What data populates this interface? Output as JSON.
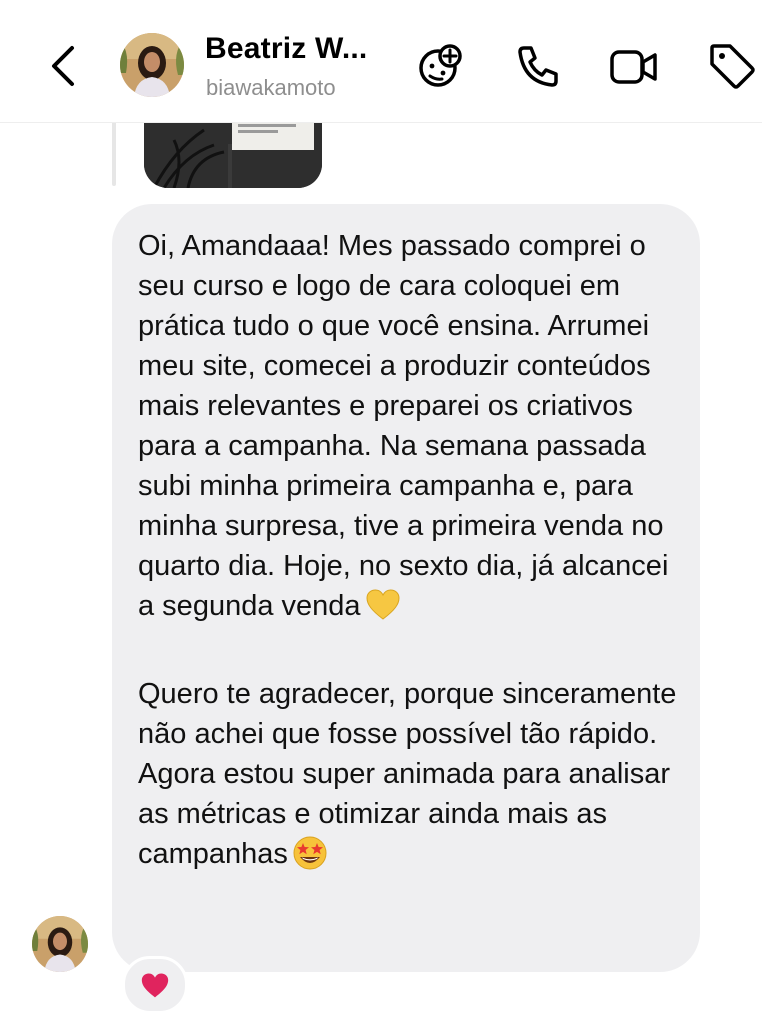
{
  "header": {
    "contact_name": "Beatriz W...",
    "contact_handle": "biawakamoto",
    "icons": [
      "back-icon",
      "add-effect-icon",
      "phone-icon",
      "video-call-icon",
      "tag-icon"
    ]
  },
  "conversation": {
    "message": {
      "paragraph_1": "Oi, Amandaaa! Mes passado comprei o seu curso e logo de cara coloquei em prática tudo o que você ensina. Arrumei meu site, comecei a produzir conteúdos mais relevantes e preparei os criativos para a campanha. Na semana passada subi minha primeira campanha e, para minha surpresa, tive a primeira venda no quarto dia. Hoje, no sexto dia, já alcancei a segunda venda",
      "paragraph_1_emoji": "yellow-heart",
      "paragraph_2": "Quero te agradecer, porque sinceramente não achei que fosse possível tão rápido. Agora estou super animada para analisar as métricas e otimizar ainda mais as campanhas",
      "paragraph_2_emoji": "star-struck"
    },
    "reaction": "red-heart",
    "colors": {
      "bubble": "#efeff1",
      "text": "#111111",
      "handle": "#8e8e8e",
      "reaction_heart": "#e0245e"
    }
  }
}
